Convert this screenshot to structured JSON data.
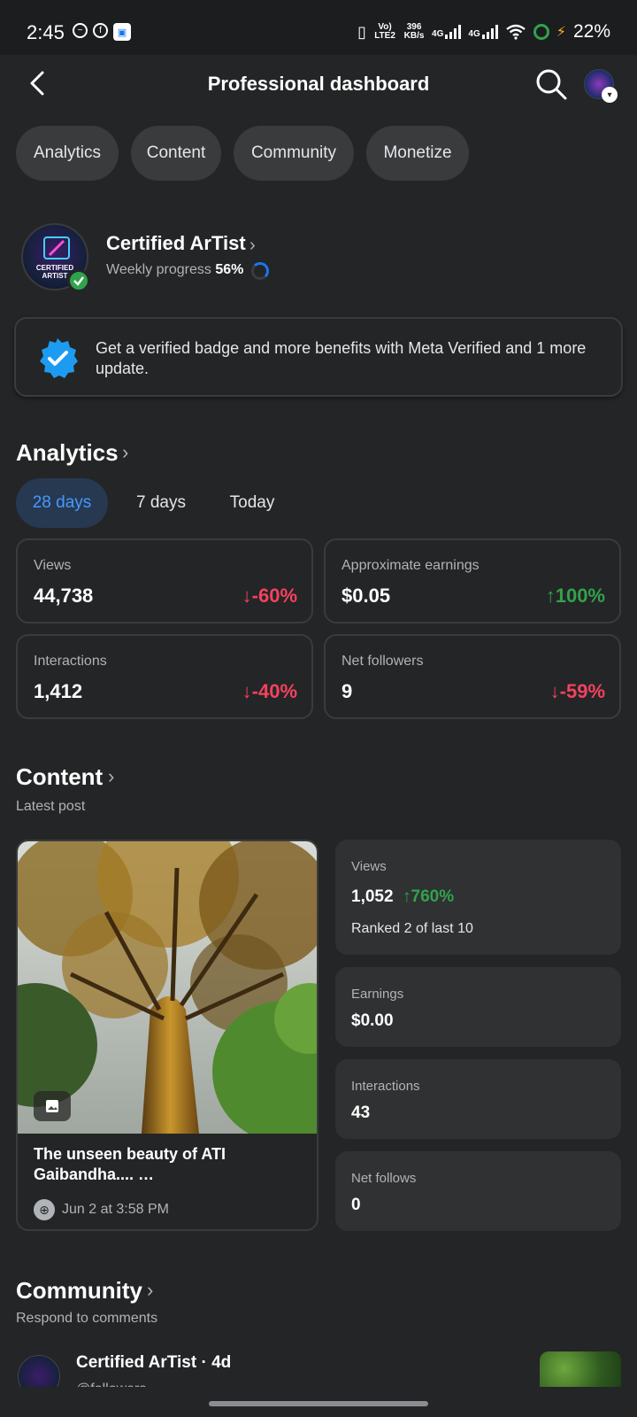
{
  "status_bar": {
    "time": "2:45",
    "volte": "Vo) LTE2",
    "speed": "396 KB/s",
    "net1": "4G",
    "net2": "4G",
    "battery": "22%"
  },
  "header": {
    "title": "Professional dashboard"
  },
  "tabs": [
    {
      "label": "Analytics"
    },
    {
      "label": "Content"
    },
    {
      "label": "Community"
    },
    {
      "label": "Monetize"
    }
  ],
  "profile": {
    "name": "Certified ArTist",
    "progress_label": "Weekly progress",
    "progress_value": "56%",
    "avatar_text": "CERTIFIED ARTIST"
  },
  "verified_card": {
    "text": "Get a verified badge and more benefits with Meta Verified and 1 more update."
  },
  "analytics": {
    "title": "Analytics",
    "ranges": [
      {
        "label": "28 days"
      },
      {
        "label": "7 days"
      },
      {
        "label": "Today"
      }
    ],
    "metrics": [
      {
        "label": "Views",
        "value": "44,738",
        "change": "-60%"
      },
      {
        "label": "Approximate earnings",
        "value": "$0.05",
        "change": "100%"
      },
      {
        "label": "Interactions",
        "value": "1,412",
        "change": "-40%"
      },
      {
        "label": "Net followers",
        "value": "9",
        "change": "-59%"
      }
    ]
  },
  "content": {
    "title": "Content",
    "subtitle": "Latest post",
    "post": {
      "caption": "The unseen beauty of ATI Gaibandha.... …",
      "date": "Jun 2 at 3:58 PM"
    },
    "stats": {
      "views_label": "Views",
      "views_value": "1,052",
      "views_change": "760%",
      "rank": "Ranked 2 of last 10",
      "earnings_label": "Earnings",
      "earnings_value": "$0.00",
      "interactions_label": "Interactions",
      "interactions_value": "43",
      "follows_label": "Net follows",
      "follows_value": "0"
    }
  },
  "community": {
    "title": "Community",
    "subtitle": "Respond to comments",
    "comment": {
      "author": "Certified ArTist · 4d",
      "text": "@followers"
    }
  }
}
